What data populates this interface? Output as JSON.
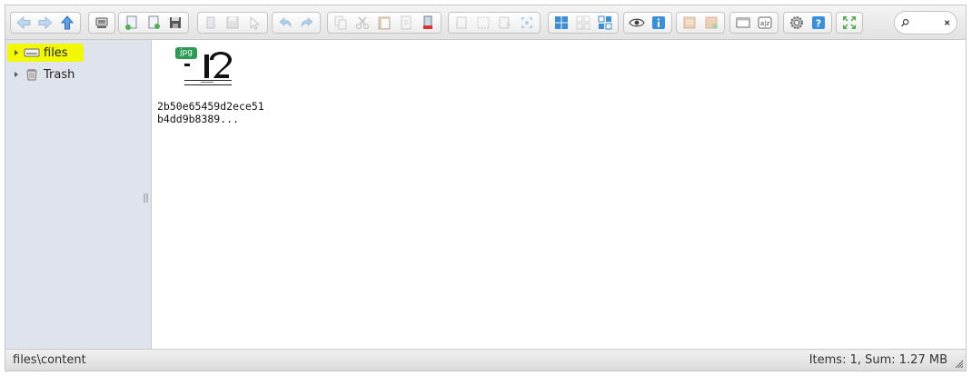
{
  "toolbar": {
    "groups": [
      {
        "id": "navigation",
        "buttons": [
          "back-icon",
          "forward-icon",
          "up-icon"
        ]
      },
      {
        "id": "places",
        "buttons": [
          "netmount-icon"
        ]
      },
      {
        "id": "file",
        "buttons": [
          "open-icon",
          "upload-icon",
          "download-icon"
        ]
      },
      {
        "id": "getfile",
        "buttons": [
          "getfile-icon",
          "save-icon",
          "select-icon"
        ]
      },
      {
        "id": "history",
        "buttons": [
          "undo-icon",
          "redo-icon"
        ]
      },
      {
        "id": "edit",
        "buttons": [
          "copy-icon",
          "cut-icon",
          "paste-icon",
          "duplicate-icon",
          "delete-icon"
        ]
      },
      {
        "id": "select",
        "buttons": [
          "select-all-icon",
          "select-none-icon",
          "select-invert-icon",
          "resize-icon"
        ]
      },
      {
        "id": "view",
        "buttons": [
          "icons-view-icon",
          "list-view-icon",
          "hidden-icon"
        ]
      },
      {
        "id": "info",
        "buttons": [
          "preview-icon",
          "info-icon"
        ]
      },
      {
        "id": "archive",
        "buttons": [
          "extract-icon",
          "archive-icon"
        ]
      },
      {
        "id": "tools",
        "buttons": [
          "rename-icon",
          "sort-icon"
        ]
      },
      {
        "id": "help",
        "buttons": [
          "preferences-icon",
          "help-icon"
        ]
      },
      {
        "id": "fullscreen",
        "buttons": [
          "fullscreen-icon"
        ]
      }
    ]
  },
  "search": {
    "value": "",
    "placeholder": ""
  },
  "sidebar": {
    "items": [
      {
        "label": "files",
        "icon": "drive-icon",
        "selected": true
      },
      {
        "label": "Trash",
        "icon": "trash-icon",
        "selected": false
      }
    ]
  },
  "files": [
    {
      "name": "2b50e65459d2ece51b4dd9b8389...",
      "ext": "jpg"
    }
  ],
  "status": {
    "path": "files\\content",
    "summary": "Items: 1, Sum: 1.27 MB"
  },
  "colors": {
    "selected_highlight": "#f2f800",
    "badge_green": "#2e9b55",
    "sidebar_bg": "#dee3ec",
    "icon_blue": "#3a8fdb"
  }
}
